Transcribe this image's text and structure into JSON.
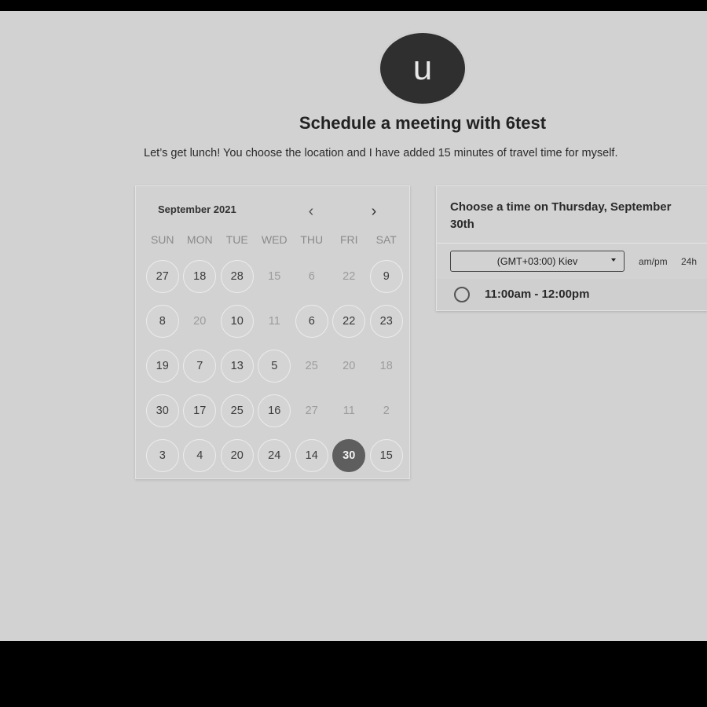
{
  "avatar": {
    "initial": "u"
  },
  "header": {
    "title": "Schedule a meeting with 6test",
    "description": "Let’s get lunch! You choose the location and I have added 15 minutes of travel time for myself."
  },
  "calendar": {
    "month_label": "September 2021",
    "weekdays": [
      "SUN",
      "MON",
      "TUE",
      "WED",
      "THU",
      "FRI",
      "SAT"
    ],
    "weeks": [
      [
        {
          "d": "27",
          "a": true
        },
        {
          "d": "18",
          "a": true
        },
        {
          "d": "28",
          "a": true
        },
        {
          "d": "15",
          "a": false
        },
        {
          "d": "6",
          "a": false
        },
        {
          "d": "22",
          "a": false
        },
        {
          "d": "9",
          "a": true
        }
      ],
      [
        {
          "d": "8",
          "a": true
        },
        {
          "d": "20",
          "a": false
        },
        {
          "d": "10",
          "a": true
        },
        {
          "d": "11",
          "a": false
        },
        {
          "d": "6",
          "a": true
        },
        {
          "d": "22",
          "a": true
        },
        {
          "d": "23",
          "a": true
        }
      ],
      [
        {
          "d": "19",
          "a": true
        },
        {
          "d": "7",
          "a": true
        },
        {
          "d": "13",
          "a": true
        },
        {
          "d": "5",
          "a": true
        },
        {
          "d": "25",
          "a": false
        },
        {
          "d": "20",
          "a": false
        },
        {
          "d": "18",
          "a": false
        }
      ],
      [
        {
          "d": "30",
          "a": true
        },
        {
          "d": "17",
          "a": true
        },
        {
          "d": "25",
          "a": true
        },
        {
          "d": "16",
          "a": true
        },
        {
          "d": "27",
          "a": false
        },
        {
          "d": "11",
          "a": false
        },
        {
          "d": "2",
          "a": false
        }
      ],
      [
        {
          "d": "3",
          "a": true
        },
        {
          "d": "4",
          "a": true
        },
        {
          "d": "20",
          "a": true
        },
        {
          "d": "24",
          "a": true
        },
        {
          "d": "14",
          "a": true
        },
        {
          "d": "30",
          "a": true,
          "selected": true
        },
        {
          "d": "15",
          "a": true
        }
      ]
    ],
    "prev_icon": "chevron-left-icon",
    "next_icon": "chevron-right-icon"
  },
  "time_panel": {
    "heading": "Choose a time on Thursday, September 30th",
    "timezone": "(GMT+03:00) Kiev",
    "format_ampm": "am/pm",
    "format_24h": "24h",
    "slots": [
      "11:00am - 12:00pm"
    ]
  }
}
